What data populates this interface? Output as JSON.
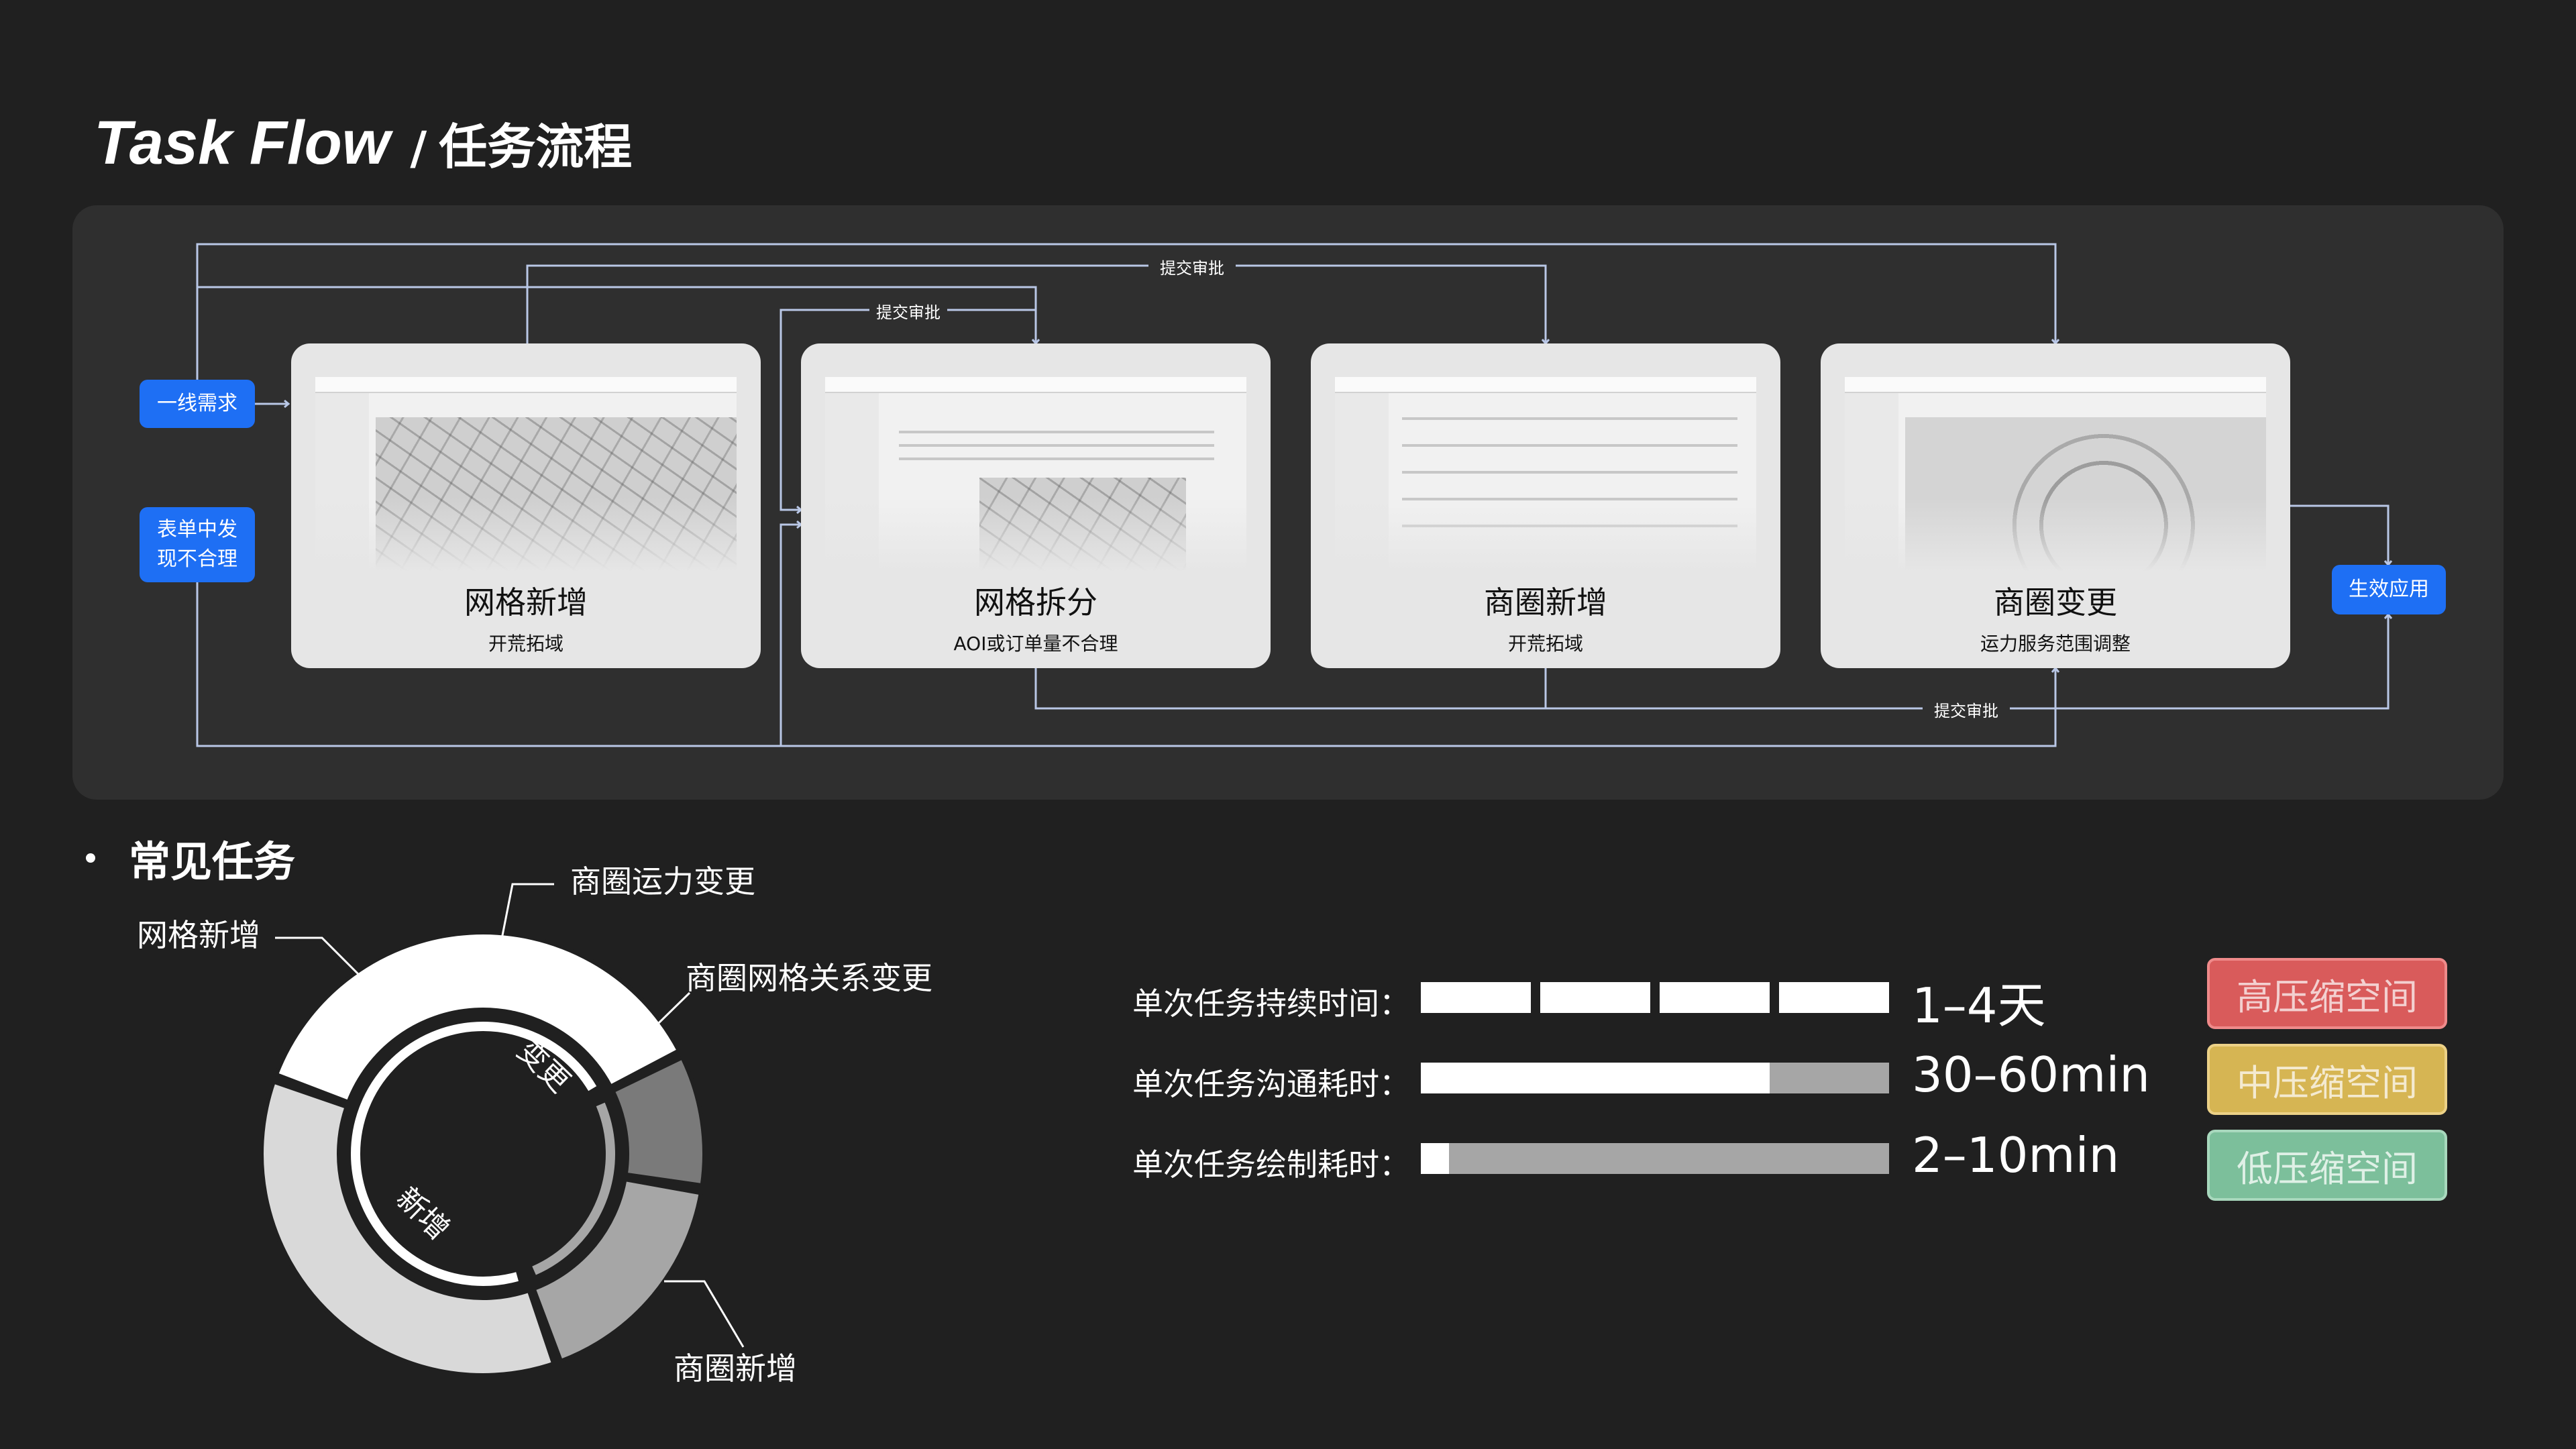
{
  "title": {
    "en": "Task Flow",
    "separator": "/",
    "cn": "任务流程"
  },
  "flow": {
    "inputs": [
      "一线需求",
      "表单中发\n现不合理"
    ],
    "output": "生效应用",
    "approval_label": "提交审批",
    "cards": [
      {
        "title": "网格新增",
        "subtitle": "开荒拓域"
      },
      {
        "title": "网格拆分",
        "subtitle": "AOI或订单量不合理"
      },
      {
        "title": "商圈新增",
        "subtitle": "开荒拓域"
      },
      {
        "title": "商圈变更",
        "subtitle": "运力服务范围调整"
      }
    ]
  },
  "section_title": "常见任务",
  "donut": {
    "inner_labels": [
      "变更",
      "新增"
    ],
    "outer_labels": {
      "grid_new": "网格新增",
      "area_capacity": "商圈运力变更",
      "area_grid_relation": "商圈网格关系变更",
      "area_new": "商圈新增"
    },
    "segments": [
      {
        "name": "网格新增",
        "share": 0.37,
        "color": "#ffffff"
      },
      {
        "name": "商圈运力变更",
        "share": 0.1,
        "color": "#7a7a7a"
      },
      {
        "name": "商圈网格关系变更",
        "share": 0.17,
        "color": "#a6a6a6"
      },
      {
        "name": "商圈新增",
        "share": 0.36,
        "color": "#d9d9d9"
      }
    ]
  },
  "metrics": [
    {
      "label": "单次任务持续时间：",
      "value": "1–4天"
    },
    {
      "label": "单次任务沟通耗时：",
      "value": "30–60min"
    },
    {
      "label": "单次任务绘制耗时：",
      "value": "2–10min"
    }
  ],
  "badges": [
    {
      "label": "高压缩空间",
      "bg": "#d95b5b",
      "border": "#ef8a8a",
      "text": "#f3d0d0"
    },
    {
      "label": "中压缩空间",
      "bg": "#d6b553",
      "border": "#ecd187",
      "text": "#f4ead0"
    },
    {
      "label": "低压缩空间",
      "bg": "#7cbf9b",
      "border": "#a8d8bd",
      "text": "#dff0e6"
    }
  ],
  "colors": {
    "flow_line": "#b9c7e6",
    "blue": "#1e6ff4",
    "bar_white": "#ffffff",
    "bar_grey": "#a6a6a6"
  }
}
